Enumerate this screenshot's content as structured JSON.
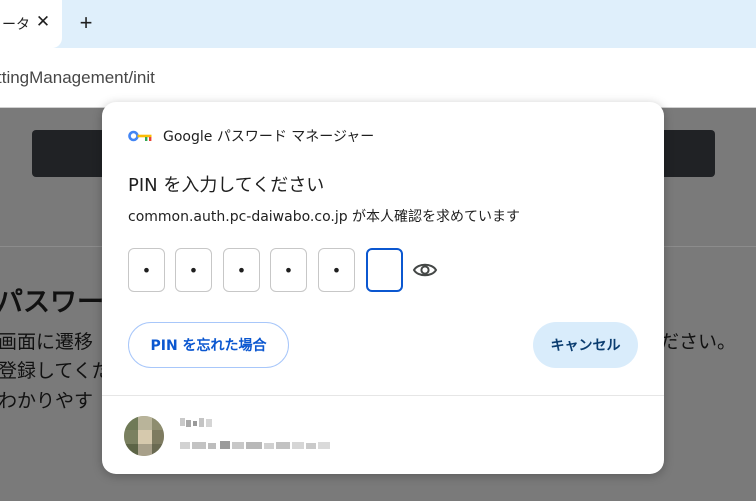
{
  "browser": {
    "tab": {
      "title": "ータ"
    },
    "new_tab_label": "+",
    "url": "ttingManagement/init"
  },
  "background_page": {
    "heading": "パスワー",
    "lines": [
      "画面に遷移",
      "登録してくだ",
      "わかりやす"
    ],
    "right_line": "ださい。"
  },
  "dialog": {
    "brand": "Google パスワード マネージャー",
    "title": "PIN を入力してください",
    "description": "common.auth.pc-daiwabo.co.jp が本人確認を求めています",
    "pin_digits": [
      "•",
      "•",
      "•",
      "•",
      "•",
      ""
    ],
    "forgot_button": "PIN を忘れた場合",
    "cancel_button": "キャンセル"
  },
  "colors": {
    "accent": "#0b57d0",
    "cancel_bg": "#d9ecfb",
    "tabstrip_bg": "#dfeffb"
  },
  "icons": [
    "google-key-icon",
    "eye-icon",
    "close-icon",
    "plus-icon",
    "avatar"
  ]
}
